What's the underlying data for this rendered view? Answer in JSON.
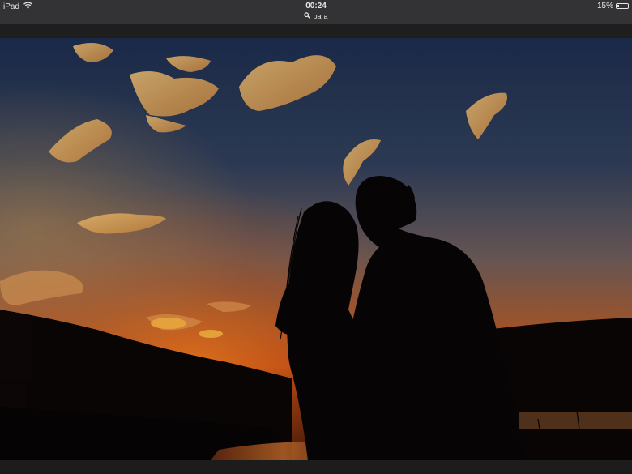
{
  "status_bar": {
    "device": "iPad",
    "time": "00:24",
    "search_text": "para",
    "battery_percent": "15%",
    "battery_level": 0.15
  },
  "photo": {
    "colors": {
      "sky_top": "#1c2c4c",
      "sky_mid": "#6a5a58",
      "horizon": "#c24a16",
      "silhouette": "#070505"
    }
  },
  "icons": [
    "wifi-icon",
    "search-icon",
    "battery-icon"
  ]
}
